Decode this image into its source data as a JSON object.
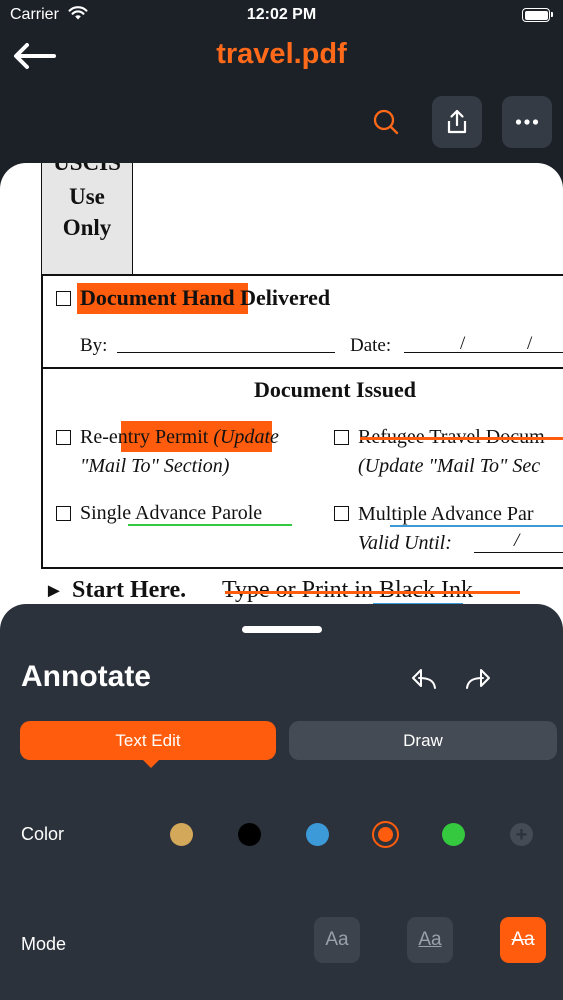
{
  "status_bar": {
    "carrier": "Carrier",
    "time": "12:02 PM"
  },
  "nav": {
    "title": "travel.pdf"
  },
  "document": {
    "uscis_line1": "USCIS",
    "uscis_line2": "Use",
    "uscis_line3": "Only",
    "delivered_highlight": "Document Hand",
    "delivered_rest": " Delivered",
    "by_label": "By:",
    "date_label": "Date:",
    "date_slash": "/",
    "issued_heading": "Document Issued",
    "reentry_prefix": "Re-",
    "reentry_highlight": "entry Permit",
    "reentry_italic_hl": "(Upd",
    "reentry_italic_rest": "ate",
    "reentry_line2": "\"Mail To\" Section)",
    "refugee_line1": "Refugee Travel Docum",
    "refugee_line2": "(Update \"Mail To\" Sec",
    "single_parole": "Single Advance Parole",
    "multiple_parole": "Multiple Advance Par",
    "valid_until": "Valid Until:",
    "start_arrow": "►",
    "start_here": "Start Here.",
    "type_print": "Type or Print in Black Ink"
  },
  "annotate": {
    "title": "Annotate",
    "tabs": {
      "text_edit": "Text Edit",
      "draw": "Draw"
    },
    "color_label": "Color",
    "mode_label": "Mode",
    "colors": [
      "#d4a85a",
      "#000000",
      "#3d9ad9",
      "#ff5d0d",
      "#35c93f"
    ],
    "selected_color": "#ff5d0d",
    "add_color": "+",
    "modes": [
      "Aa",
      "Aa",
      "Aa"
    ]
  }
}
